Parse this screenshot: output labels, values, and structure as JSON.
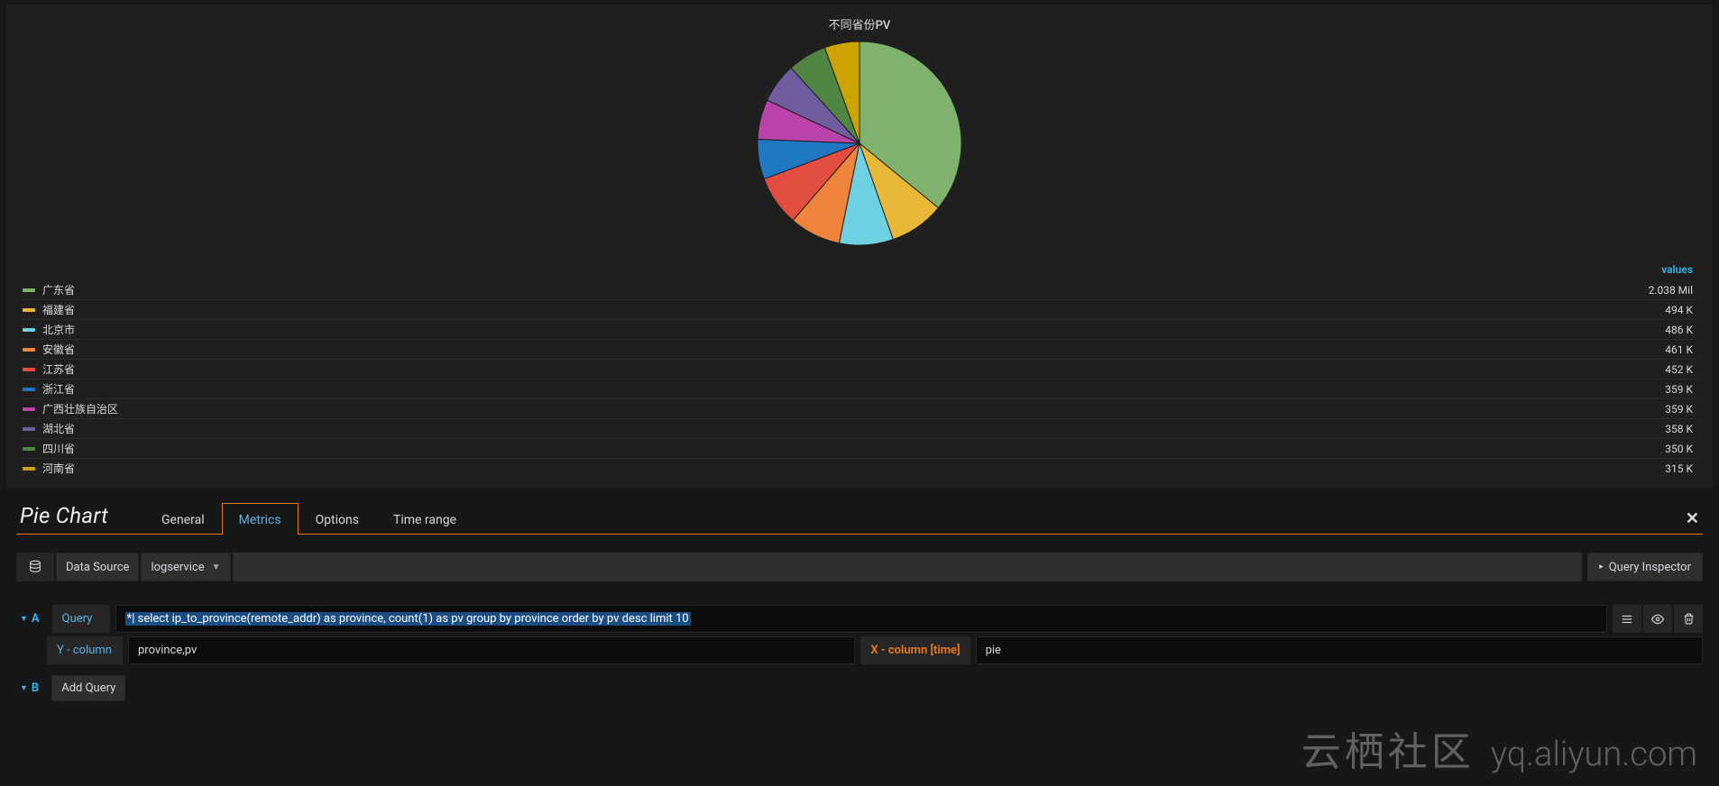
{
  "chart_data": {
    "type": "pie",
    "title": "不同省份PV",
    "legend_value_header": "values",
    "slices": [
      {
        "name": "广东省",
        "label": "2.038 Mil",
        "value": 2038000,
        "color": "#7eb26d"
      },
      {
        "name": "福建省",
        "label": "494 K",
        "value": 494000,
        "color": "#eab839"
      },
      {
        "name": "北京市",
        "label": "486 K",
        "value": 486000,
        "color": "#6ed0e0"
      },
      {
        "name": "安徽省",
        "label": "461 K",
        "value": 461000,
        "color": "#ef843c"
      },
      {
        "name": "江苏省",
        "label": "452 K",
        "value": 452000,
        "color": "#e24d42"
      },
      {
        "name": "浙江省",
        "label": "359 K",
        "value": 359000,
        "color": "#1f78c1"
      },
      {
        "name": "广西壮族自治区",
        "label": "359 K",
        "value": 359000,
        "color": "#ba43a9"
      },
      {
        "name": "湖北省",
        "label": "358 K",
        "value": 358000,
        "color": "#705da0"
      },
      {
        "name": "四川省",
        "label": "350 K",
        "value": 350000,
        "color": "#508642"
      },
      {
        "name": "河南省",
        "label": "315 K",
        "value": 315000,
        "color": "#cca300"
      }
    ]
  },
  "editor": {
    "panel_type": "Pie Chart",
    "tabs": {
      "general": "General",
      "metrics": "Metrics",
      "options": "Options",
      "time_range": "Time range"
    },
    "data_source_label": "Data Source",
    "data_source_value": "logservice",
    "query_inspector": "Query Inspector"
  },
  "query": {
    "row_letter": "A",
    "query_label": "Query",
    "query_text": "*| select ip_to_province(remote_addr) as province, count(1) as pv group by province order by pv desc  limit 10",
    "y_label": "Y - column",
    "y_value": "province,pv",
    "x_label": "X - column [time]",
    "x_value": "pie",
    "row_letter_b": "B",
    "add_query": "Add Query"
  },
  "watermark": {
    "cjk": "云栖社区",
    "url": "yq.aliyun.com"
  }
}
